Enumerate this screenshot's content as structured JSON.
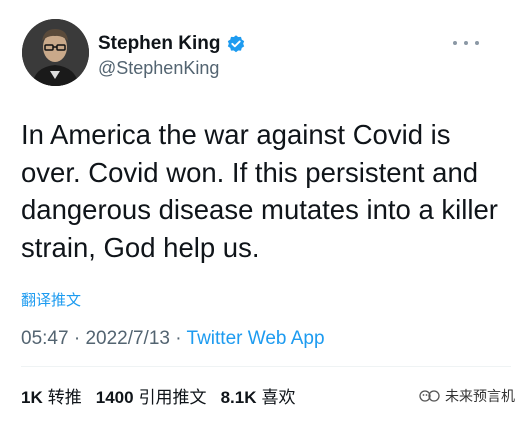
{
  "author": {
    "name": "Stephen King",
    "handle": "@StephenKing",
    "verified": true
  },
  "tweet": {
    "text": "In America the war against Covid is over. Covid won. If this persistent and dangerous disease mutates into a killer strain, God help us."
  },
  "translate_label": "翻译推文",
  "meta": {
    "time": "05:47",
    "separator": " · ",
    "date": "2022/7/13",
    "separator2": " · ",
    "client": "Twitter Web App"
  },
  "stats": [
    {
      "count": "1K",
      "label": "转推"
    },
    {
      "count": "1400",
      "label": "引用推文"
    },
    {
      "count": "8.1K",
      "label": "喜欢"
    }
  ],
  "watermark": {
    "text": "未来预言机"
  },
  "colors": {
    "link": "#1d9bf0",
    "secondary": "#536471",
    "verified": "#1d9bf0"
  },
  "icons": {
    "verified": "verified-badge-icon",
    "more": "more-dots-icon"
  }
}
